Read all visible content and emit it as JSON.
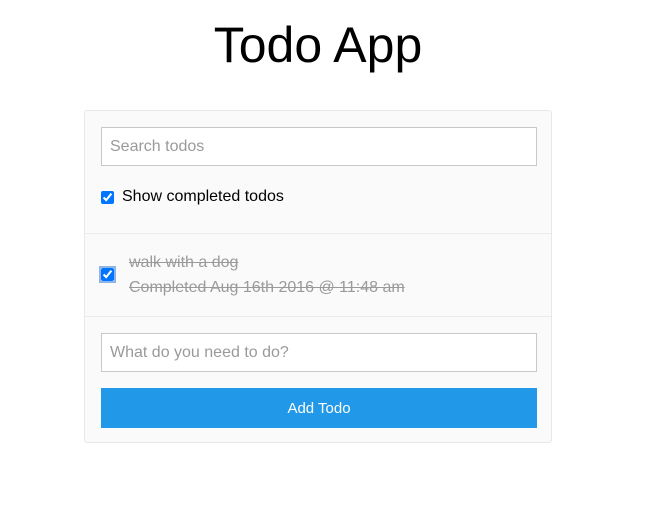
{
  "app": {
    "title": "Todo App"
  },
  "search": {
    "placeholder": "Search todos",
    "value": ""
  },
  "filter": {
    "show_completed_label": "Show completed todos",
    "show_completed_checked": true
  },
  "todos": [
    {
      "text": "walk with a dog",
      "completed": true,
      "status_text": "Completed Aug 16th 2016 @ 11:48 am"
    }
  ],
  "add_todo": {
    "placeholder": "What do you need to do?",
    "value": "",
    "button_label": "Add Todo"
  },
  "colors": {
    "button_background": "#2199e8",
    "completed_text": "#9a9a9a"
  }
}
